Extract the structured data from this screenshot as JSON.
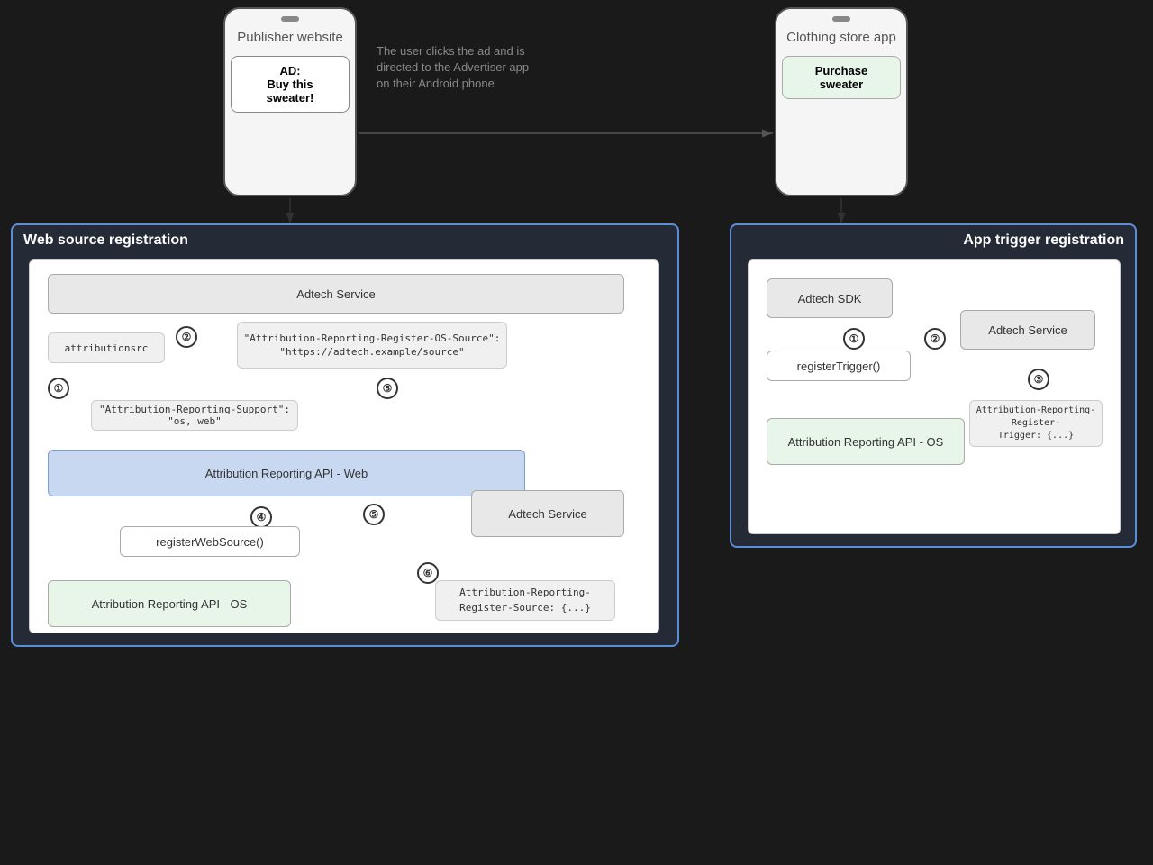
{
  "phones": {
    "publisher": {
      "title": "Publisher website",
      "ad_label": "AD:",
      "ad_text": "Buy this sweater!"
    },
    "clothing": {
      "title": "Clothing store app",
      "button": "Purchase sweater"
    }
  },
  "description": "The user clicks the ad and is directed to the Advertiser app on their Android phone",
  "left_section": {
    "title": "Web source registration",
    "adtech_service_top": "Adtech Service",
    "attribution_src": "attributionsrc",
    "header_response": "\"Attribution-Reporting-Register-OS-Source\":\n\"https://adtech.example/source\"",
    "support_header": "\"Attribution-Reporting-Support\": \"os, web\"",
    "attribution_api_web": "Attribution Reporting API - Web",
    "step2_label": "②",
    "step1_label": "①",
    "step3_label": "③",
    "step4_label": "④",
    "step5_label": "⑤",
    "step6_label": "⑥",
    "register_web_source": "registerWebSource()",
    "adtech_service_bottom": "Adtech Service",
    "attr_register_source": "Attribution-Reporting-\nRegister-Source: {...}",
    "attribution_api_os": "Attribution Reporting API - OS"
  },
  "right_section": {
    "title": "App trigger registration",
    "adtech_sdk": "Adtech SDK",
    "step1_label": "①",
    "register_trigger": "registerTrigger()",
    "step2_label": "②",
    "adtech_service": "Adtech Service",
    "step3_label": "③",
    "attribution_api_os": "Attribution Reporting API - OS",
    "attr_register_trigger": "Attribution-Reporting-Register-\nTrigger: {...}"
  }
}
